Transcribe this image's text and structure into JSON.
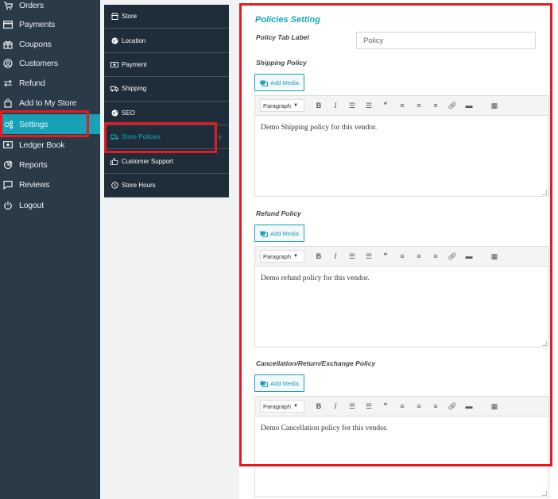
{
  "sidebar": {
    "items": [
      {
        "label": "Orders",
        "icon": "cart-icon"
      },
      {
        "label": "Payments",
        "icon": "credit-card-icon"
      },
      {
        "label": "Coupons",
        "icon": "gift-icon"
      },
      {
        "label": "Customers",
        "icon": "user-circle-icon"
      },
      {
        "label": "Refund",
        "icon": "refund-icon"
      },
      {
        "label": "Add to My Store",
        "icon": "shopping-bag-icon"
      },
      {
        "label": "Settings",
        "icon": "gears-icon"
      },
      {
        "label": "Ledger Book",
        "icon": "money-icon"
      },
      {
        "label": "Reports",
        "icon": "chart-pie-icon"
      },
      {
        "label": "Reviews",
        "icon": "comment-icon"
      },
      {
        "label": "Logout",
        "icon": "power-icon"
      }
    ],
    "active": "Settings"
  },
  "settings_menu": {
    "items": [
      {
        "label": "Store",
        "icon": "store-icon"
      },
      {
        "label": "Location",
        "icon": "globe-icon"
      },
      {
        "label": "Payment",
        "icon": "money-icon"
      },
      {
        "label": "Shipping",
        "icon": "truck-icon"
      },
      {
        "label": "SEO",
        "icon": "globe-icon"
      },
      {
        "label": "Store Policies",
        "icon": "policies-icon"
      },
      {
        "label": "Customer Support",
        "icon": "thumbs-up-icon"
      },
      {
        "label": "Store Hours",
        "icon": "clock-icon"
      }
    ],
    "active": "Store Policies"
  },
  "content": {
    "title": "Policies Setting",
    "tab_label": {
      "label": "Policy Tab Label",
      "value": "Policy"
    },
    "add_media_label": "Add Media",
    "toolbar": {
      "paragraph": "Paragraph"
    },
    "policies": [
      {
        "label": "Shipping Policy",
        "text": "Demo Shipping policy for this vendor."
      },
      {
        "label": "Refund Policy",
        "text": "Demo refund policy for this vendor."
      },
      {
        "label": "Cancellation/Return/Exchange Policy",
        "text": "Demo Cancellation policy for this vendor."
      }
    ]
  },
  "colors": {
    "sidebar_bg": "#2b3a47",
    "submenu_bg": "#1f2d3a",
    "accent": "#17a2b8",
    "highlight": "#e31b23"
  }
}
